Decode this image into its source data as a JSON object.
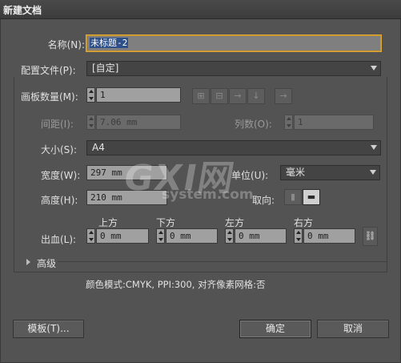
{
  "window": {
    "title": "新建文档"
  },
  "name": {
    "label": "名称(N):",
    "value": "未标题-2"
  },
  "profile": {
    "label": "配置文件(P):",
    "value": "[自定]"
  },
  "artboards": {
    "label": "画板数量(M):",
    "value": "1"
  },
  "spacing": {
    "label": "间距(I):",
    "value": "7.06 mm"
  },
  "columns": {
    "label": "列数(O):",
    "value": "1"
  },
  "size": {
    "label": "大小(S):",
    "value": "A4"
  },
  "width": {
    "label": "宽度(W):",
    "value": "297 mm"
  },
  "units": {
    "label": "单位(U):",
    "value": "毫米"
  },
  "height": {
    "label": "高度(H):",
    "value": "210 mm"
  },
  "orientation": {
    "label": "取向:"
  },
  "bleed": {
    "label": "出血(L):",
    "top": {
      "label": "上方",
      "value": "0 mm"
    },
    "bottom": {
      "label": "下方",
      "value": "0 mm"
    },
    "left": {
      "label": "左方",
      "value": "0 mm"
    },
    "right": {
      "label": "右方",
      "value": "0 mm"
    }
  },
  "advanced": {
    "label": "高级"
  },
  "summary": "颜色模式:CMYK, PPI:300, 对齐像素网格:否",
  "buttons": {
    "templates": "模板(T)...",
    "ok": "确定",
    "cancel": "取消"
  },
  "watermark": {
    "logo": "GXI网",
    "site": "system.com"
  },
  "colors": {
    "background": "#535353",
    "focus": "#e0a838",
    "field": "#a0a0a0"
  }
}
